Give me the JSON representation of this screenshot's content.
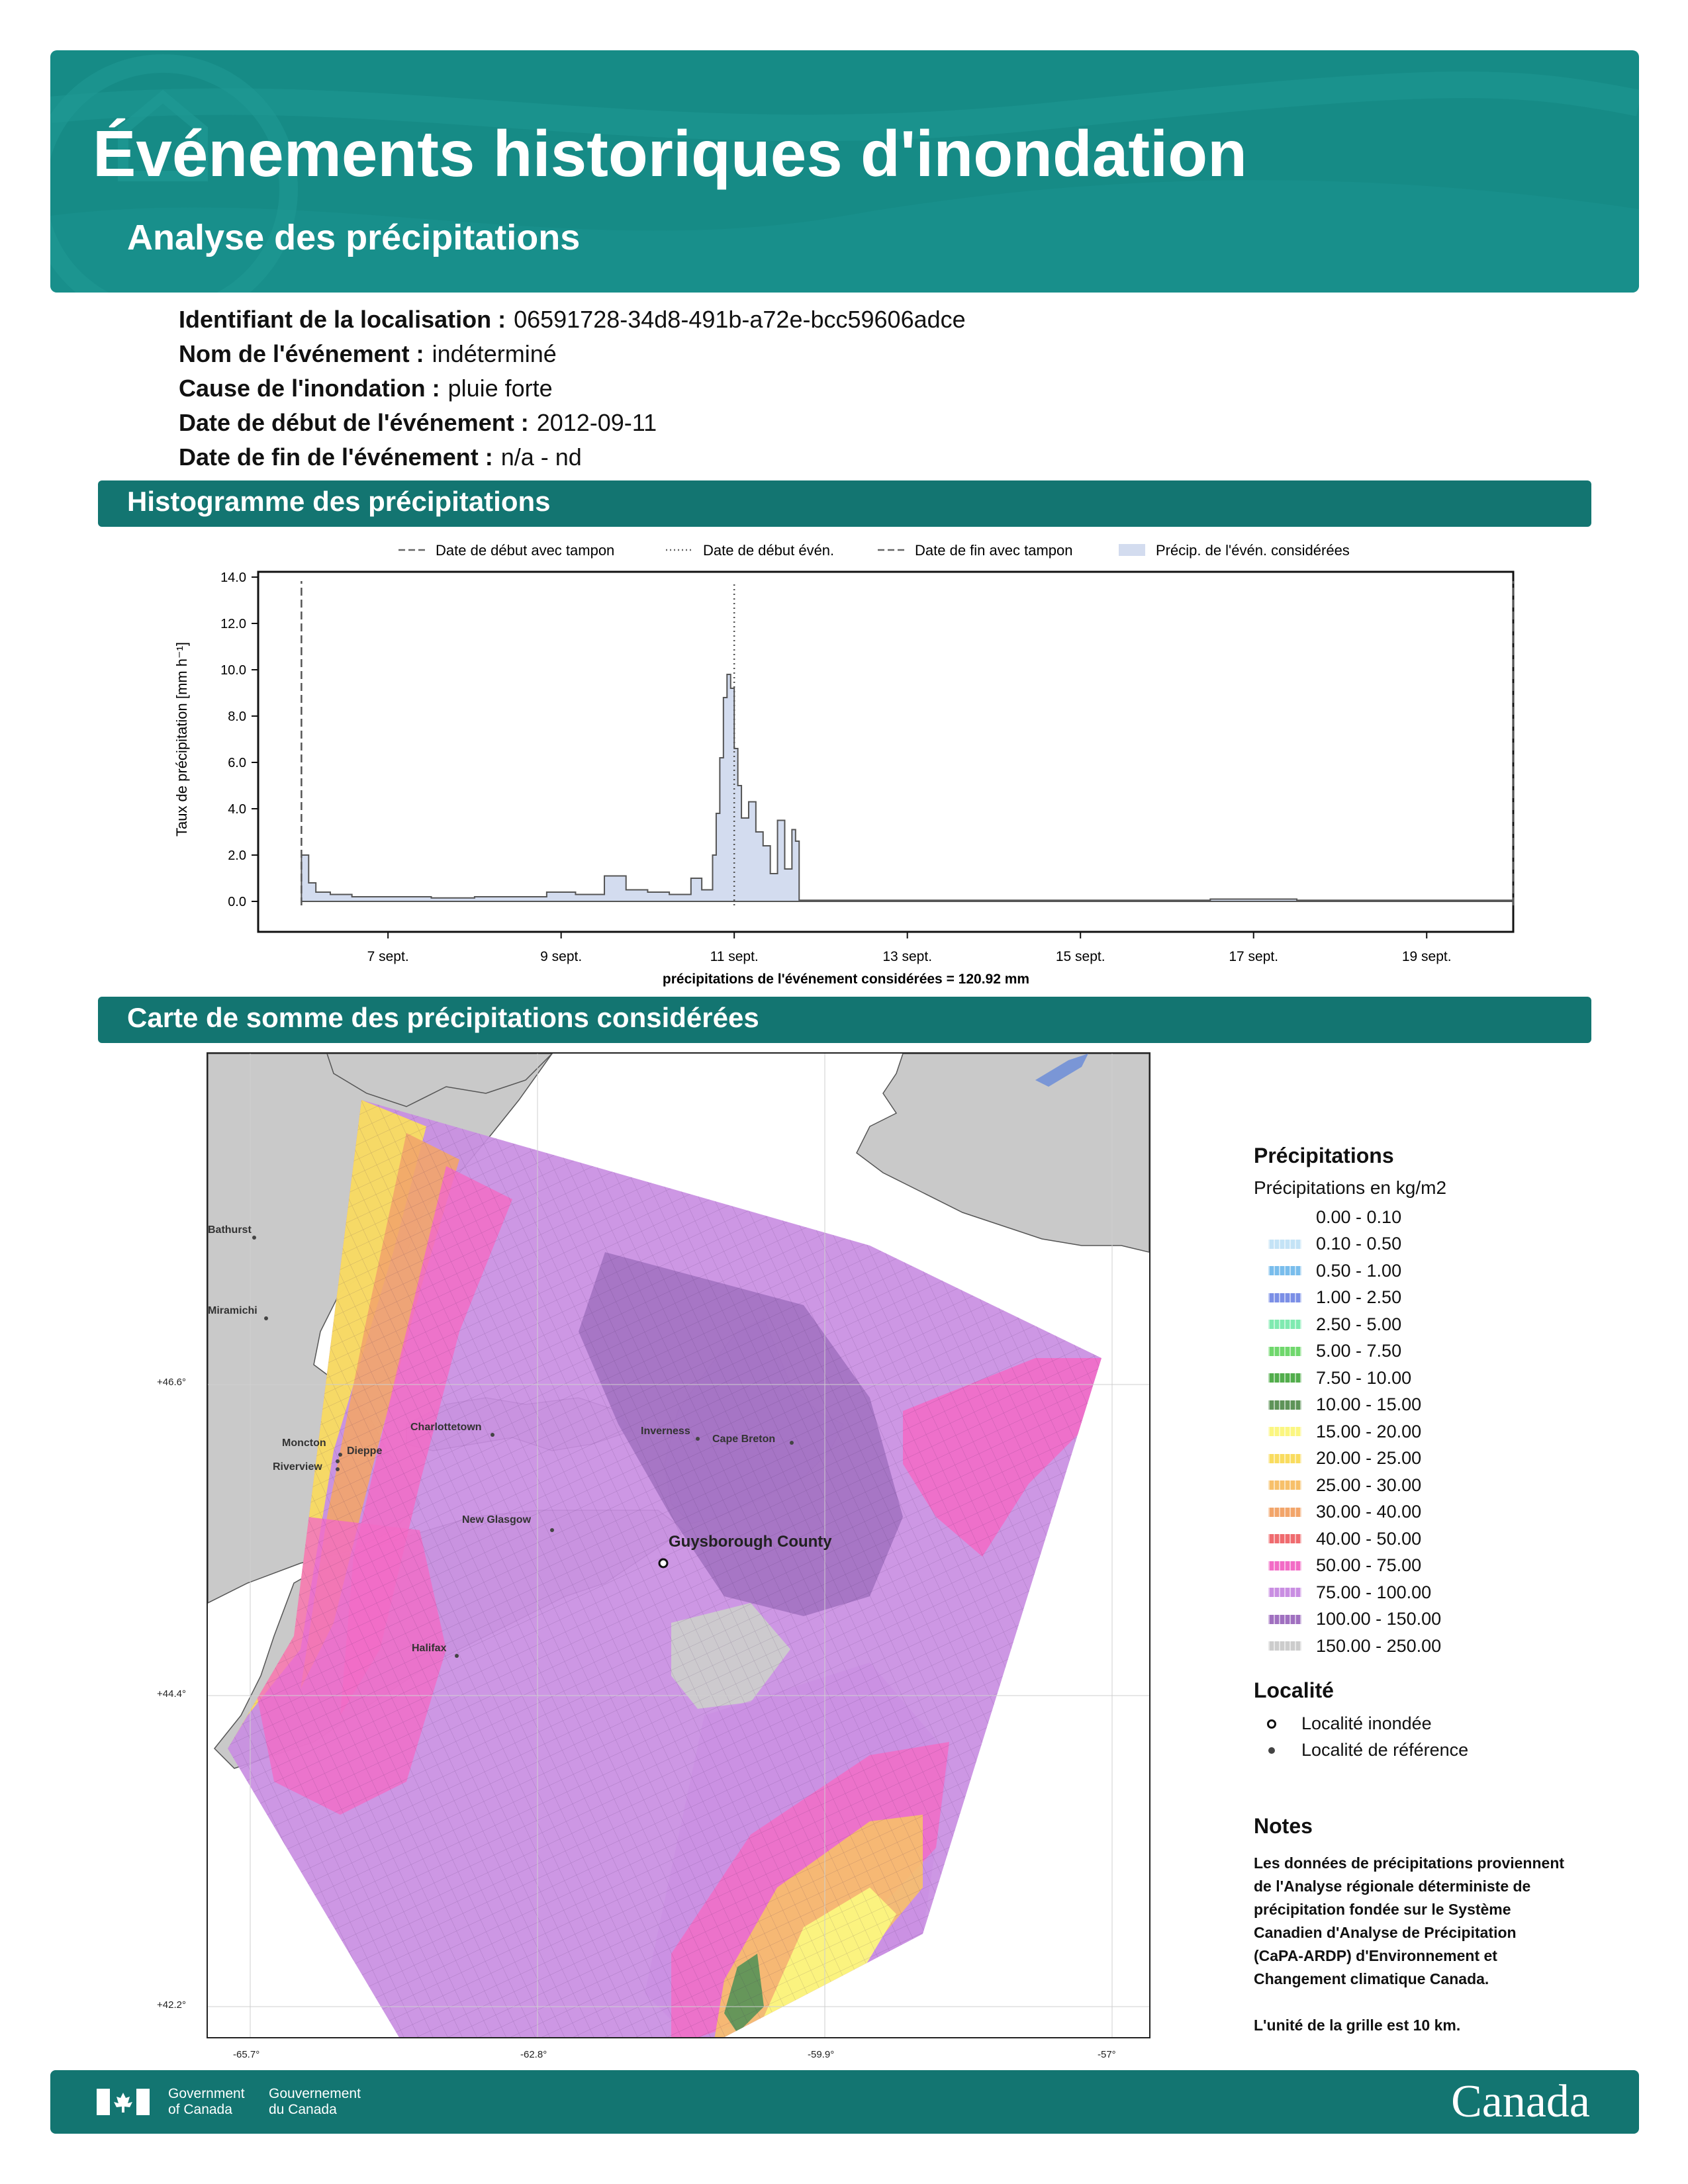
{
  "header": {
    "title": "Événements historiques d'inondation",
    "subtitle": "Analyse des précipitations"
  },
  "info": [
    {
      "label": "Identifiant de la localisation :",
      "value": "06591728-34d8-491b-a72e-bcc59606adce"
    },
    {
      "label": "Nom de l'événement :",
      "value": "indéterminé"
    },
    {
      "label": "Cause de l'inondation :",
      "value": "pluie forte"
    },
    {
      "label": "Date de début de l'événement :",
      "value": "2012-09-11"
    },
    {
      "label": "Date de fin de l'événement :",
      "value": "n/a - nd"
    }
  ],
  "sections": {
    "histogram": "Histogramme des précipitations",
    "map": "Carte de somme des précipitations considérées"
  },
  "chart_data": {
    "type": "area",
    "title": "",
    "xlabel": "précipitations de l'événement considérées = 120.92 mm",
    "ylabel": "Taux de précipitation [mm h⁻¹]",
    "ylim": [
      0,
      14
    ],
    "xlim": [
      "2012-09-05 12:00",
      "2012-09-20 00:00"
    ],
    "y_ticks": [
      "0.0",
      "2.0",
      "4.0",
      "6.0",
      "8.0",
      "10.0",
      "12.0",
      "14.0"
    ],
    "x_ticks": [
      "7 sept.",
      "9 sept.",
      "11 sept.",
      "13 sept.",
      "15 sept.",
      "17 sept.",
      "19 sept."
    ],
    "x_tick_dates": [
      "2012-09-07",
      "2012-09-09",
      "2012-09-11",
      "2012-09-13",
      "2012-09-15",
      "2012-09-17",
      "2012-09-19"
    ],
    "legend": {
      "placement": "top",
      "entries": [
        {
          "label": "Date de début avec tampon",
          "style": "dashed"
        },
        {
          "label": "Date de début évén.",
          "style": "dotted"
        },
        {
          "label": "Date de fin avec tampon",
          "style": "dashed"
        },
        {
          "label": "Précip. de l'évén. considérées",
          "style": "fill"
        }
      ]
    },
    "vlines": [
      {
        "date": "2012-09-06",
        "style": "dashed"
      },
      {
        "date": "2012-09-11",
        "style": "dotted"
      },
      {
        "date": "2012-09-20",
        "style": "dashed"
      }
    ],
    "colors": {
      "fill": "#d3dcef",
      "line": "#555555"
    },
    "series": [
      {
        "x": [
          "2012-09-06 00:00",
          "2012-09-06 02:00",
          "2012-09-06 04:00",
          "2012-09-06 08:00",
          "2012-09-06 14:00",
          "2012-09-07 00:00",
          "2012-09-07 12:00",
          "2012-09-08 00:00",
          "2012-09-08 12:00",
          "2012-09-08 20:00",
          "2012-09-09 04:00",
          "2012-09-09 12:00",
          "2012-09-09 18:00",
          "2012-09-10 00:00",
          "2012-09-10 06:00",
          "2012-09-10 12:00",
          "2012-09-10 15:00",
          "2012-09-10 18:00",
          "2012-09-10 19:00",
          "2012-09-10 20:00",
          "2012-09-10 21:00",
          "2012-09-10 22:00",
          "2012-09-10 23:00",
          "2012-09-11 00:00",
          "2012-09-11 01:00",
          "2012-09-11 02:00",
          "2012-09-11 04:00",
          "2012-09-11 06:00",
          "2012-09-11 08:00",
          "2012-09-11 10:00",
          "2012-09-11 12:00",
          "2012-09-11 14:00",
          "2012-09-11 16:00",
          "2012-09-11 17:00",
          "2012-09-11 18:00",
          "2012-09-11 20:00",
          "2012-09-11 22:00",
          "2012-09-12 00:00",
          "2012-09-12 12:00",
          "2012-09-13 12:00",
          "2012-09-14 12:00",
          "2012-09-15 12:00",
          "2012-09-16 12:00",
          "2012-09-17 12:00",
          "2012-09-18 12:00",
          "2012-09-19 12:00",
          "2012-09-20 00:00"
        ],
        "y": [
          2.0,
          0.8,
          0.4,
          0.3,
          0.2,
          0.2,
          0.15,
          0.2,
          0.2,
          0.4,
          0.3,
          1.1,
          0.5,
          0.4,
          0.3,
          1.0,
          0.5,
          2.0,
          3.8,
          6.2,
          8.8,
          9.8,
          9.2,
          6.6,
          5.0,
          3.6,
          4.3,
          3.0,
          2.4,
          1.2,
          3.5,
          1.4,
          3.1,
          2.6,
          0.05,
          0.05,
          0.05,
          0.05,
          0.05,
          0.05,
          0.05,
          0.05,
          0.1,
          0.05,
          0.05,
          0.05,
          0.05
        ]
      }
    ]
  },
  "map": {
    "cities": [
      "Bathurst",
      "Miramichi",
      "Charlottetown",
      "Moncton",
      "Dieppe",
      "Riverview",
      "New Glasgow",
      "Inverness",
      "Cape Breton",
      "Halifax"
    ],
    "flooded_locality": "Guysborough County",
    "lat_ticks": [
      "+46.6°",
      "+44.4°",
      "+42.2°"
    ],
    "lon_ticks": [
      "-65.7°",
      "-62.8°",
      "-59.9°",
      "-57°"
    ]
  },
  "legend": {
    "title": "Précipitations",
    "subtitle": "Précipitations en kg/m2",
    "items": [
      {
        "label": "0.00 - 0.10",
        "color": ""
      },
      {
        "label": "0.10 - 0.50",
        "color": "#c4e3f6"
      },
      {
        "label": "0.50 - 1.00",
        "color": "#79bdec"
      },
      {
        "label": "1.00 - 2.50",
        "color": "#7b8fe6"
      },
      {
        "label": "2.50 - 5.00",
        "color": "#7feab0"
      },
      {
        "label": "5.00 - 7.50",
        "color": "#6fd76c"
      },
      {
        "label": "7.50 - 10.00",
        "color": "#52ad4c"
      },
      {
        "label": "10.00 - 15.00",
        "color": "#5e9358"
      },
      {
        "label": "15.00 - 20.00",
        "color": "#fbf680"
      },
      {
        "label": "20.00 - 25.00",
        "color": "#f9dc5f"
      },
      {
        "label": "25.00 - 30.00",
        "color": "#f7c06a"
      },
      {
        "label": "30.00 - 40.00",
        "color": "#f2a56a"
      },
      {
        "label": "40.00 - 50.00",
        "color": "#ef6b6f"
      },
      {
        "label": "50.00 - 75.00",
        "color": "#f26cc6"
      },
      {
        "label": "75.00 - 100.00",
        "color": "#c98ee2"
      },
      {
        "label": "100.00 - 150.00",
        "color": "#a070c0"
      },
      {
        "label": "150.00 - 250.00",
        "color": "#cccccc"
      }
    ],
    "locality_title": "Localité",
    "localities": [
      "Localité inondée",
      "Localité de référence"
    ]
  },
  "notes": {
    "title": "Notes",
    "lines": [
      "Les données de précipitations proviennent",
      "de l'Analyse régionale déterministe de",
      "précipitation fondée sur le Système",
      "Canadien d'Analyse de Précipitation",
      "(CaPA-ARDP) d'Environnement et",
      "Changement climatique Canada.",
      "",
      "L'unité de la grille est 10 km."
    ]
  },
  "footer": {
    "gov_en_1": "Government",
    "gov_en_2": "of Canada",
    "gov_fr_1": "Gouvernement",
    "gov_fr_2": "du Canada",
    "wordmark": "Canada"
  }
}
